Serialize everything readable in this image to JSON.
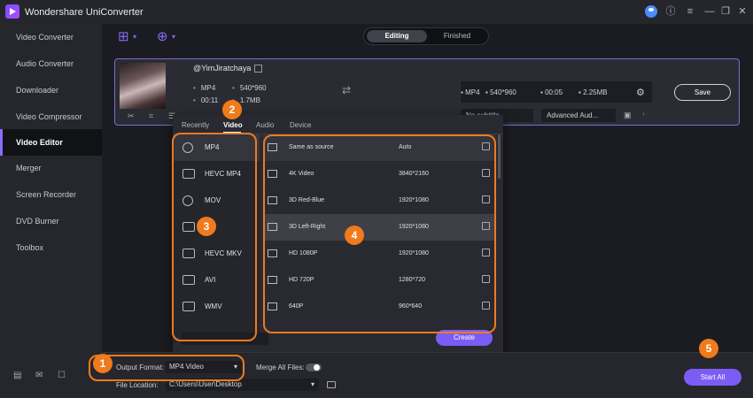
{
  "app": {
    "title": "Wondershare UniConverter",
    "window_controls": [
      "⓪",
      "≡",
      "—",
      "❐",
      "✕"
    ]
  },
  "sidebar": {
    "items": [
      {
        "label": "Video Converter"
      },
      {
        "label": "Audio Converter"
      },
      {
        "label": "Downloader"
      },
      {
        "label": "Video Compressor"
      },
      {
        "label": "Video Editor",
        "active": true
      },
      {
        "label": "Merger"
      },
      {
        "label": "Screen Recorder"
      },
      {
        "label": "DVD Burner"
      },
      {
        "label": "Toolbox"
      }
    ],
    "footer_icons": [
      "book-icon",
      "mail-icon",
      "feedback-icon"
    ]
  },
  "toolbar": {
    "add_files_icon": "add-file-icon",
    "add_media_icon": "add-media-icon",
    "tabs": [
      {
        "label": "Editing",
        "active": true
      },
      {
        "label": "Finished"
      }
    ]
  },
  "file": {
    "name": "@YimJiratchaya",
    "source_format": "MP4",
    "source_resolution": "540*960",
    "source_duration": "00:11",
    "source_size": "1.7MB",
    "output_format": "MP4",
    "output_resolution": "540*960",
    "output_duration": "00:05",
    "output_size": "2.25MB",
    "save_label": "Save",
    "subtitle_select": "No subtitle",
    "audio_select": "Advanced Aud..."
  },
  "format_popup": {
    "tabs": [
      {
        "label": "Recently"
      },
      {
        "label": "Video",
        "active": true
      },
      {
        "label": "Audio"
      },
      {
        "label": "Device"
      }
    ],
    "formats": [
      {
        "label": "MP4",
        "icon": "disc",
        "active": true
      },
      {
        "label": "HEVC MP4",
        "icon": "film"
      },
      {
        "label": "MOV",
        "icon": "disc"
      },
      {
        "label": "",
        "icon": "film"
      },
      {
        "label": "HEVC MKV",
        "icon": "film"
      },
      {
        "label": "AVI",
        "icon": "film"
      },
      {
        "label": "WMV",
        "icon": "film"
      }
    ],
    "resolutions": [
      {
        "name": "Same as source",
        "value": "Auto",
        "active": true
      },
      {
        "name": "4K Video",
        "value": "3840*2160"
      },
      {
        "name": "3D Red-Blue",
        "value": "1920*1080"
      },
      {
        "name": "3D Left-Right",
        "value": "1920*1080",
        "hover": true
      },
      {
        "name": "HD 1080P",
        "value": "1920*1080"
      },
      {
        "name": "HD 720P",
        "value": "1280*720"
      },
      {
        "name": "640P",
        "value": "960*640"
      }
    ],
    "create_label": "Create"
  },
  "bottom": {
    "output_format_label": "Output Format:",
    "output_format_value": "MP4 Video",
    "merge_label": "Merge All Files:",
    "file_location_label": "File Location:",
    "file_location_value": "C:\\Users\\User\\Desktop",
    "start_all_label": "Start All"
  },
  "callouts": [
    "1",
    "2",
    "3",
    "4",
    "5"
  ],
  "colors": {
    "accent": "#7b5cf5",
    "callout": "#f07a1c",
    "card_border": "#7c6bd6"
  }
}
